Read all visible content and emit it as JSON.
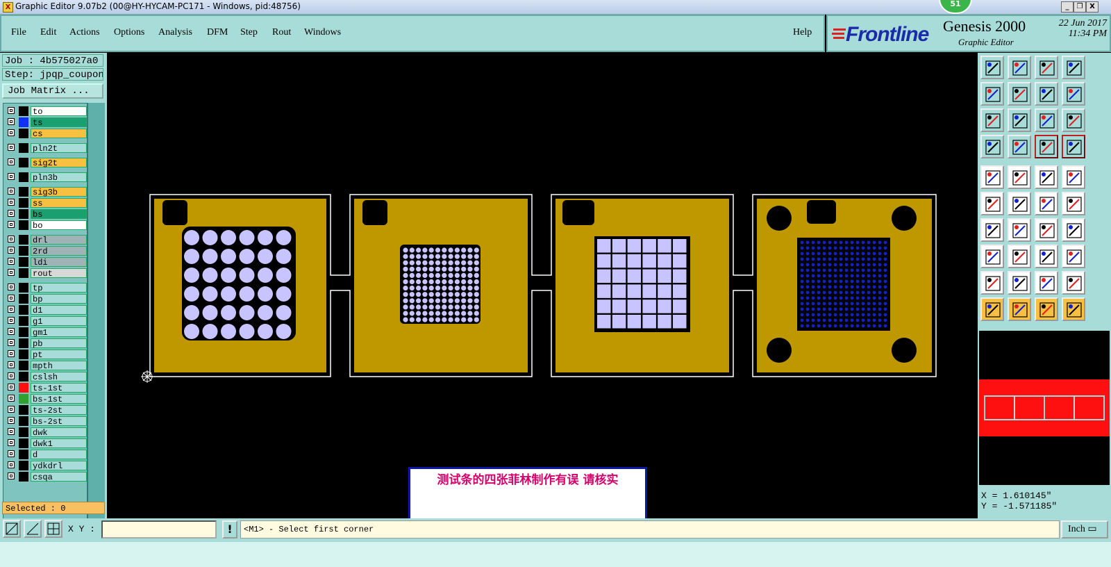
{
  "window": {
    "title": "Graphic Editor 9.07b2 (00@HY-HYCAM-PC171 - Windows, pid:48756)",
    "notification_count": "51",
    "buttons": {
      "minimize": "_",
      "restore": "❐",
      "close": "X"
    }
  },
  "menu": [
    "File",
    "Edit",
    "Actions",
    "Options",
    "Analysis",
    "DFM",
    "Step",
    "Rout",
    "Windows"
  ],
  "help_label": "Help",
  "brand": {
    "logo": "Frontline",
    "product": "Genesis 2000",
    "subtitle": "Graphic Editor",
    "date": "22 Jun 2017",
    "time": "11:34 PM"
  },
  "left_panel": {
    "job": "Job : 4b575027a0",
    "step": "Step: jpqp_coupon",
    "job_matrix_button": "Job Matrix ...",
    "selected": "Selected : 0",
    "layers": [
      {
        "name": "to",
        "fill": "#ffffff",
        "swatch": "#000000",
        "group": 0
      },
      {
        "name": "ts",
        "fill": "#1aa070",
        "swatch": "#1030ff",
        "group": 0
      },
      {
        "name": "cs",
        "fill": "#f8c040",
        "swatch": "#000000",
        "group": 0
      },
      {
        "name": "pln2t",
        "fill": "#a8dcd8",
        "swatch": "#000000",
        "group": 1
      },
      {
        "name": "sig2t",
        "fill": "#f8c040",
        "swatch": "#000000",
        "group": 2
      },
      {
        "name": "pln3b",
        "fill": "#a8dcd8",
        "swatch": "#000000",
        "group": 3
      },
      {
        "name": "sig3b",
        "fill": "#f8c040",
        "swatch": "#000000",
        "group": 4
      },
      {
        "name": "ss",
        "fill": "#f8c040",
        "swatch": "#000000",
        "group": 4
      },
      {
        "name": "bs",
        "fill": "#1aa070",
        "swatch": "#000000",
        "group": 4
      },
      {
        "name": "bo",
        "fill": "#ffffff",
        "swatch": "#000000",
        "group": 4
      },
      {
        "name": "drl",
        "fill": "#a0b4b8",
        "swatch": "#000000",
        "group": 5
      },
      {
        "name": "2rd",
        "fill": "#a0b4b8",
        "swatch": "#000000",
        "group": 5
      },
      {
        "name": "ldi",
        "fill": "#a0b4b8",
        "swatch": "#000000",
        "group": 5
      },
      {
        "name": "rout",
        "fill": "#d8d8d8",
        "swatch": "#000000",
        "group": 5
      },
      {
        "name": "tp",
        "fill": "#a8dcd8",
        "swatch": "#000000",
        "group": 6
      },
      {
        "name": "bp",
        "fill": "#a8dcd8",
        "swatch": "#000000",
        "group": 6
      },
      {
        "name": "d1",
        "fill": "#a8dcd8",
        "swatch": "#000000",
        "group": 6
      },
      {
        "name": "g1",
        "fill": "#a8dcd8",
        "swatch": "#000000",
        "group": 6
      },
      {
        "name": "gm1",
        "fill": "#a8dcd8",
        "swatch": "#000000",
        "group": 6
      },
      {
        "name": "pb",
        "fill": "#a8dcd8",
        "swatch": "#000000",
        "group": 6
      },
      {
        "name": "pt",
        "fill": "#a8dcd8",
        "swatch": "#000000",
        "group": 6
      },
      {
        "name": "mpth",
        "fill": "#a8dcd8",
        "swatch": "#000000",
        "group": 6
      },
      {
        "name": "cslsh",
        "fill": "#a8dcd8",
        "swatch": "#000000",
        "group": 6
      },
      {
        "name": "ts-1st",
        "fill": "#a8dcd8",
        "swatch": "#ff1010",
        "group": 6
      },
      {
        "name": "bs-1st",
        "fill": "#a8dcd8",
        "swatch": "#30a030",
        "group": 6
      },
      {
        "name": "ts-2st",
        "fill": "#a8dcd8",
        "swatch": "#000000",
        "group": 6
      },
      {
        "name": "bs-2st",
        "fill": "#a8dcd8",
        "swatch": "#000000",
        "group": 6
      },
      {
        "name": "dwk",
        "fill": "#a8dcd8",
        "swatch": "#000000",
        "group": 6
      },
      {
        "name": "dwk1",
        "fill": "#a8dcd8",
        "swatch": "#000000",
        "group": 6
      },
      {
        "name": "d",
        "fill": "#a8dcd8",
        "swatch": "#000000",
        "group": 6
      },
      {
        "name": "ydkdrl",
        "fill": "#a8dcd8",
        "swatch": "#000000",
        "group": 6
      },
      {
        "name": "csqa",
        "fill": "#a8dcd8",
        "swatch": "#000000",
        "group": 6
      }
    ]
  },
  "colors": {
    "panel": "#a8dcd8",
    "copper": "#bf9800",
    "pad": "#c8c4ff",
    "board_outline": "#ffffff",
    "highlight_blue": "#1020d0",
    "popup_text": "#d4006c",
    "minimap_red": "#ff1010"
  },
  "coords": {
    "x": "X =  1.610145\"",
    "y": "Y = -1.571185\""
  },
  "bottom": {
    "xy_label": "X Y :",
    "xy_value": "",
    "prompt": "<M1> - Select first corner",
    "units": "Inch"
  },
  "popup": {
    "message": "测试条的四张菲林制作有误   请核实"
  },
  "toolbox_icons": [
    "zoom-home-top-icon",
    "zoom-home-bottom-icon",
    "home-icon",
    "split-view-icon",
    "pan-left-icon",
    "pan-right-icon",
    "redraw-icon",
    "snap-icon",
    "fit-vertical-icon",
    "fit-all-icon",
    "scale-1-2-icon",
    "help-query-icon",
    "measure-icon",
    "grid-icon",
    "layer-compare-icon",
    "layer-compare-alt-icon",
    "pad-select-icon",
    "pad-edit-icon",
    "ruler-icon",
    "circle-select-icon",
    "connect-icon",
    "cross-icon",
    "line-draw-icon",
    "line-draw-alt-icon",
    "angle-icon",
    "slope-icon",
    "rotate-icon",
    "text-ff-icon",
    "pad-red-icon",
    "line-red-icon",
    "dimension-icon",
    "shape-blue-icon",
    "arc-red-icon",
    "arc-up-icon",
    "arc-blue-icon",
    "arc-blue-alt-icon",
    "select-pointer-icon",
    "select-pointer-box-icon",
    "select-pointer-circle-icon",
    "select-pointer-route-icon"
  ]
}
